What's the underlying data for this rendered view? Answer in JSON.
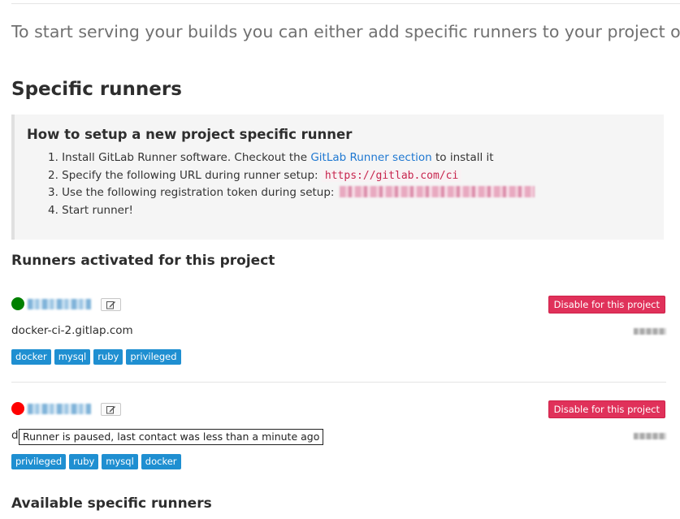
{
  "intro_text": "To start serving your builds you can either add specific runners to your project or use shared runners",
  "specific_heading": "Specific runners",
  "setup": {
    "title": "How to setup a new project specific runner",
    "step1_prefix": "1. Install GitLab Runner software. Checkout the ",
    "step1_link": "GitLab Runner section",
    "step1_suffix": " to install it",
    "step2_prefix": "2. Specify the following URL during runner setup: ",
    "step2_url": "https://gitlab.com/ci",
    "step3_prefix": "3. Use the following registration token during setup: ",
    "step4": "4. Start runner!"
  },
  "activated_heading": "Runners activated for this project",
  "runners": [
    {
      "status": "active",
      "status_color": "#008000",
      "description": "docker-ci-2.gitlap.com",
      "disable_label": "Disable for this project",
      "tags": [
        "docker",
        "mysql",
        "ruby",
        "privileged"
      ]
    },
    {
      "status": "paused",
      "status_color": "#ff0000",
      "description": "d",
      "disable_label": "Disable for this project",
      "tags": [
        "privileged",
        "ruby",
        "mysql",
        "docker"
      ]
    }
  ],
  "tooltip_text": "Runner is paused, last contact was less than a minute ago",
  "available_heading": "Available specific runners",
  "icons": {
    "edit": "edit-icon"
  },
  "colors": {
    "link": "#1f78d1",
    "danger": "#e0315a",
    "tag": "#1f8fd1",
    "code": "#c7254e"
  }
}
